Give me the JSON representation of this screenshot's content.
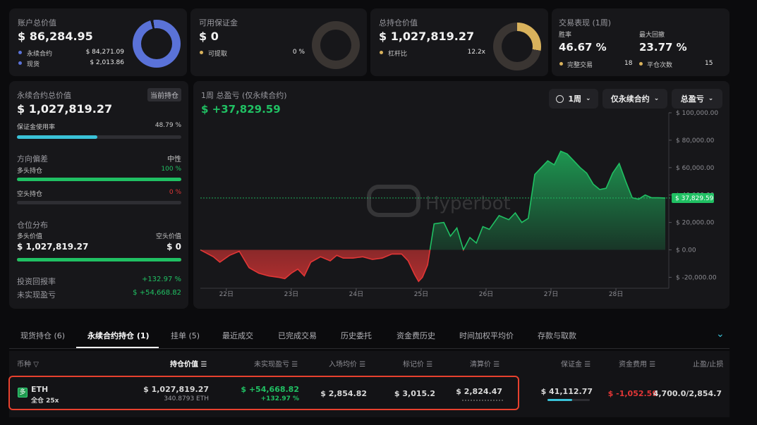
{
  "account": {
    "label": "账户总价值",
    "value": "$ 86,284.95",
    "rows": [
      {
        "label": "永续合约",
        "value": "$ 84,271.09"
      },
      {
        "label": "现货",
        "value": "$ 2,013.86"
      }
    ]
  },
  "margin": {
    "label": "可用保证金",
    "value": "$ 0",
    "rows": [
      {
        "label": "可提取",
        "value": "0 %"
      }
    ]
  },
  "position_value": {
    "label": "总持仓价值",
    "value": "$ 1,027,819.27",
    "rows": [
      {
        "label": "杠杆比",
        "value": "12.2x"
      }
    ]
  },
  "performance": {
    "label": "交易表现 (1周)",
    "winrate_label": "胜率",
    "winrate": "46.67 %",
    "drawdown_label": "最大回撤",
    "drawdown": "23.77 %",
    "completed_label": "完整交易",
    "completed": "18",
    "closes_label": "平仓次数",
    "closes": "15"
  },
  "perp": {
    "label": "永续合约总价值",
    "badge": "当前持仓",
    "value": "$ 1,027,819.27",
    "usage_label": "保证金使用率",
    "usage": "48.79 %",
    "usage_fraction": 0.4879,
    "bias_label": "方向偏差",
    "bias": "中性",
    "long_label": "多头持仓",
    "long_pct": "100 %",
    "long_fraction": 1.0,
    "short_label": "空头持仓",
    "short_pct": "0 %",
    "short_fraction": 0.0,
    "dist_label": "仓位分布",
    "dist_long_label": "多头价值",
    "dist_short_label": "空头价值",
    "dist_long": "$ 1,027,819.27",
    "dist_short": "$ 0",
    "dist_fraction": 1.0,
    "roi_label": "投资回报率",
    "roi": "+132.97 %",
    "upnl_label": "未实现盈亏",
    "upnl": "$ +54,668.82"
  },
  "pnl_panel": {
    "title": "1周 总盈亏 (仅永续合约)",
    "value": "$ +37,829.59",
    "filters": [
      "1周",
      "仅永续合约",
      "总盈亏"
    ],
    "watermark": "Hyperbot"
  },
  "chart_data": {
    "type": "area",
    "title": "1周 总盈亏 (仅永续合约)",
    "x_ticks": [
      "22日",
      "23日",
      "24日",
      "25日",
      "26日",
      "27日",
      "28日"
    ],
    "x_tick_positions": [
      22,
      23,
      24,
      25,
      26,
      27,
      28
    ],
    "y_ticks": [
      "$ 100,000.00",
      "$ 80,000.00",
      "$ 60,000.00",
      "$ 40,000.00",
      "$ 20,000.00",
      "$ 0.00",
      "$ -20,000.00"
    ],
    "y_tick_values": [
      100000,
      80000,
      60000,
      40000,
      20000,
      0,
      -20000
    ],
    "ylim": [
      -28000,
      100000
    ],
    "xlim": [
      21.6,
      28.76
    ],
    "current_label": "$ 37,829.59",
    "current_value": 37829.59,
    "colors": {
      "positive": "#20c063",
      "negative": "#e23636",
      "label_bg": "#20c063"
    },
    "x": [
      21.6,
      21.8,
      21.9,
      22.05,
      22.2,
      22.35,
      22.5,
      22.65,
      22.8,
      22.9,
      23.0,
      23.1,
      23.2,
      23.3,
      23.45,
      23.6,
      23.7,
      23.8,
      23.95,
      24.1,
      24.25,
      24.4,
      24.55,
      24.7,
      24.8,
      24.9,
      24.96,
      25.02,
      25.1,
      25.2,
      25.35,
      25.45,
      25.55,
      25.65,
      25.75,
      25.85,
      25.95,
      26.05,
      26.2,
      26.35,
      26.45,
      26.55,
      26.65,
      26.75,
      26.85,
      26.95,
      27.05,
      27.15,
      27.25,
      27.35,
      27.45,
      27.55,
      27.65,
      27.75,
      27.85,
      27.95,
      28.05,
      28.15,
      28.25,
      28.35,
      28.45,
      28.55,
      28.65,
      28.76
    ],
    "y": [
      0,
      -5000,
      -9000,
      -4000,
      -1000,
      -13000,
      -17000,
      -19000,
      -20000,
      -21000,
      -17000,
      -14000,
      -19000,
      -9000,
      -5000,
      -8000,
      -4000,
      -6000,
      -6000,
      -5000,
      -7000,
      -6000,
      -3000,
      -3000,
      -8000,
      -18000,
      -23000,
      -20000,
      -11000,
      19000,
      20000,
      10000,
      16000,
      0,
      9000,
      5000,
      17000,
      15000,
      25000,
      22000,
      27000,
      20000,
      23000,
      55000,
      60000,
      65000,
      62000,
      72000,
      70000,
      65000,
      60000,
      56000,
      48000,
      44000,
      45000,
      56000,
      63000,
      50000,
      38000,
      37000,
      40000,
      38000,
      38000,
      37829.59
    ]
  },
  "tabs": [
    "现货持仓 (6)",
    "永续合约持仓 (1)",
    "挂单 (5)",
    "最近成交",
    "已完成交易",
    "历史委托",
    "资金费历史",
    "时间加权平均价",
    "存款与取款"
  ],
  "table": {
    "headers": [
      "币种",
      "持仓价值",
      "未实现盈亏",
      "入场均价",
      "标记价",
      "清算价",
      "保证金",
      "资金费用",
      "止盈/止损"
    ],
    "row": {
      "side": "多",
      "coin": "ETH",
      "mode": "全仓 25x",
      "value": "$ 1,027,819.27",
      "size": "340.8793 ETH",
      "upnl": "$ +54,668.82",
      "upnl_pct": "+132.97 %",
      "entry": "$ 2,854.82",
      "mark": "$ 3,015.2",
      "liq": "$ 2,824.47",
      "margin": "$ 41,112.77",
      "margin_fraction": 0.58,
      "funding": "$ -1,052.59",
      "tpsl": "4,700.0/2,854.7"
    }
  },
  "colors": {
    "accent_blue": "#5a72d8",
    "gold": "#d9b25c",
    "green": "#20c063",
    "red": "#e23636",
    "teal": "#3ac2d8",
    "highlight": "#e8412e"
  }
}
